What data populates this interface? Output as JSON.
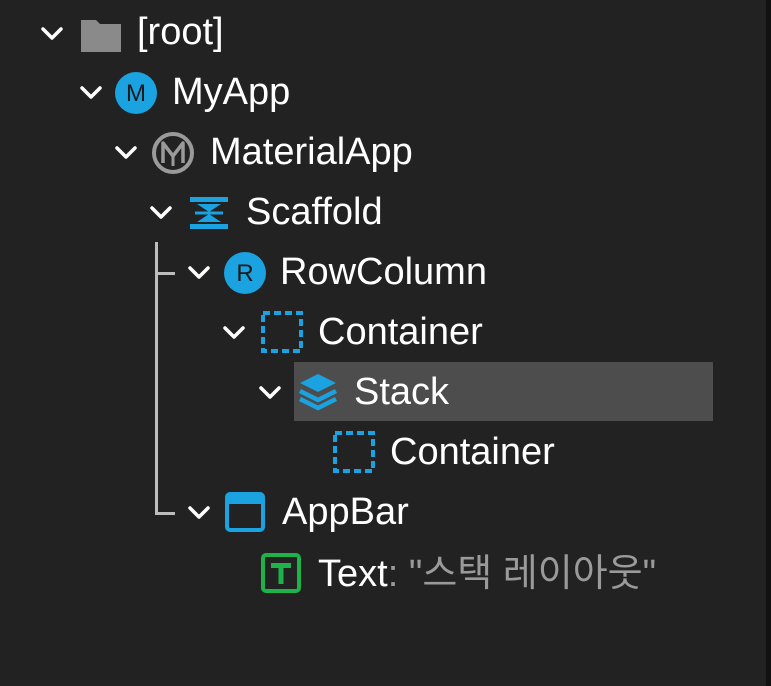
{
  "tree": {
    "root": {
      "label": "[root]",
      "icon": "folder-icon"
    },
    "myapp": {
      "label": "MyApp",
      "icon": "circle-m-icon",
      "letter": "M"
    },
    "material_app": {
      "label": "MaterialApp",
      "icon": "material-app-icon"
    },
    "scaffold": {
      "label": "Scaffold",
      "icon": "scaffold-icon"
    },
    "row_column": {
      "label": "RowColumn",
      "icon": "circle-r-icon",
      "letter": "R"
    },
    "container_1": {
      "label": "Container",
      "icon": "dashed-square-icon"
    },
    "stack": {
      "label": "Stack",
      "icon": "layers-icon",
      "selected": true
    },
    "container_2": {
      "label": "Container",
      "icon": "dashed-square-icon"
    },
    "appbar": {
      "label": "AppBar",
      "icon": "window-icon"
    },
    "text": {
      "label": "Text",
      "icon": "text-t-icon",
      "value_prefix": ": ",
      "value": "\"스택 레이아웃\""
    }
  },
  "colors": {
    "background": "#222222",
    "selection": "#4d4d4d",
    "accent_blue": "#1aa3e0",
    "text_green": "#1db24a",
    "folder_gray": "#8a8a8a",
    "muted_text": "#9a9a9a"
  }
}
